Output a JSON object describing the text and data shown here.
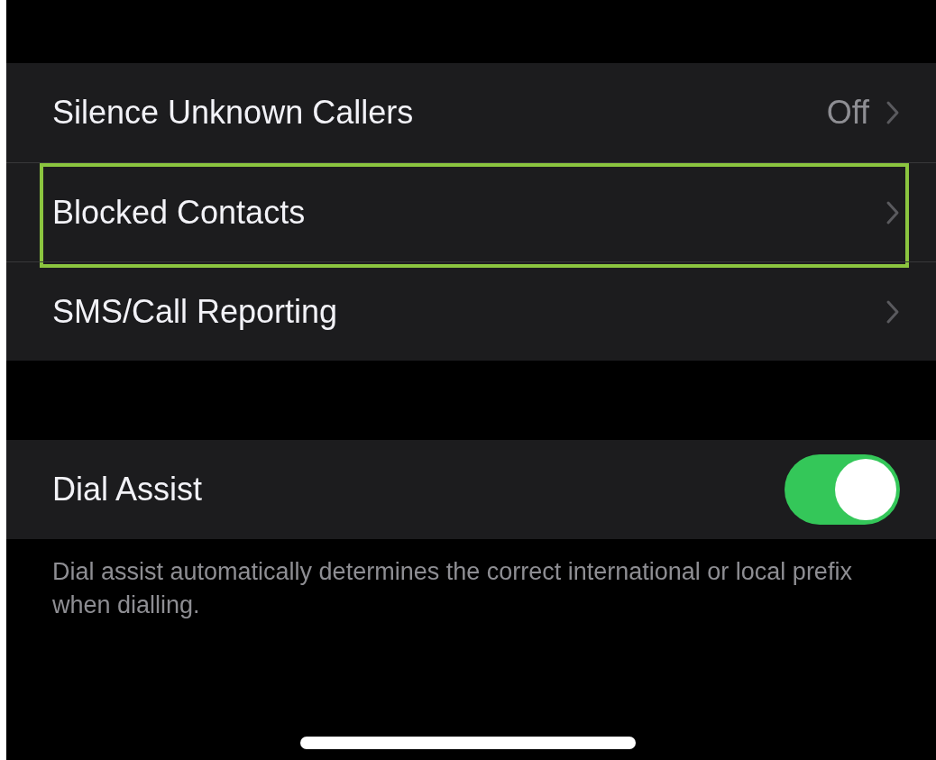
{
  "groups": [
    {
      "rows": [
        {
          "kind": "link",
          "label": "Silence Unknown Callers",
          "value": "Off",
          "highlighted": false
        },
        {
          "kind": "link",
          "label": "Blocked Contacts",
          "highlighted": true
        },
        {
          "kind": "link",
          "label": "SMS/Call Reporting",
          "highlighted": false
        }
      ]
    },
    {
      "rows": [
        {
          "kind": "toggle",
          "label": "Dial Assist",
          "on": true
        }
      ],
      "footer": "Dial assist automatically determines the correct international or local prefix when dialling."
    }
  ]
}
